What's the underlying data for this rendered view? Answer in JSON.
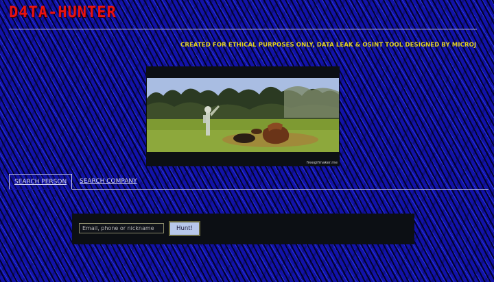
{
  "header": {
    "title": "D4TA-HUNTER"
  },
  "marquee": {
    "text": "CREATED FOR ETHICAL PURPOSES ONLY, DATA LEAK & OSINT TOOL DESIGNED BY MICROJ"
  },
  "video": {
    "watermark": "freegifmaker.me"
  },
  "tabs": [
    {
      "label": "SEARCH PERSON",
      "active": true
    },
    {
      "label": "SEARCH COMPANY",
      "active": false
    }
  ],
  "search": {
    "placeholder": "Email, phone or nickname",
    "value": "",
    "button_label": "Hunt!"
  },
  "colors": {
    "title": "#e81212",
    "marquee": "#e0d020",
    "background": "#1212a8",
    "panel": "#0c0f14"
  }
}
